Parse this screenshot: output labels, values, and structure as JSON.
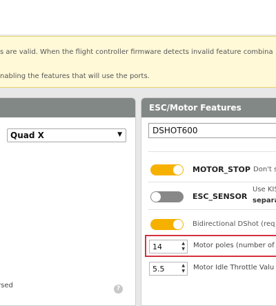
{
  "notice": {
    "line1": "s are valid. When the flight controller firmware detects invalid feature combina",
    "line2": "nabling the features that will use the ports."
  },
  "mixer_panel": {
    "mixer_value": "Quad X",
    "footer_text": "rsed",
    "help_symbol": "?"
  },
  "esc_panel": {
    "title": "ESC/Motor Features",
    "protocol_value": "DSHOT600",
    "features": [
      {
        "name": "MOTOR_STOP",
        "enabled": true,
        "description": "Don't s"
      },
      {
        "name": "ESC_SENSOR",
        "enabled": false,
        "description_line1": "Use KIS",
        "description_line2": "separa"
      }
    ],
    "bidir_dshot": {
      "enabled": true,
      "label": "Bidirectional DShot (req"
    },
    "motor_poles": {
      "value": "14",
      "label": "Motor poles (number of"
    },
    "idle_throttle": {
      "value": "5.5",
      "label": "Motor Idle Throttle Valu"
    }
  },
  "colors": {
    "toggle_on": "#f6b100",
    "toggle_off": "#888888",
    "highlight_box": "#d4313f",
    "panel_header": "#828885"
  }
}
